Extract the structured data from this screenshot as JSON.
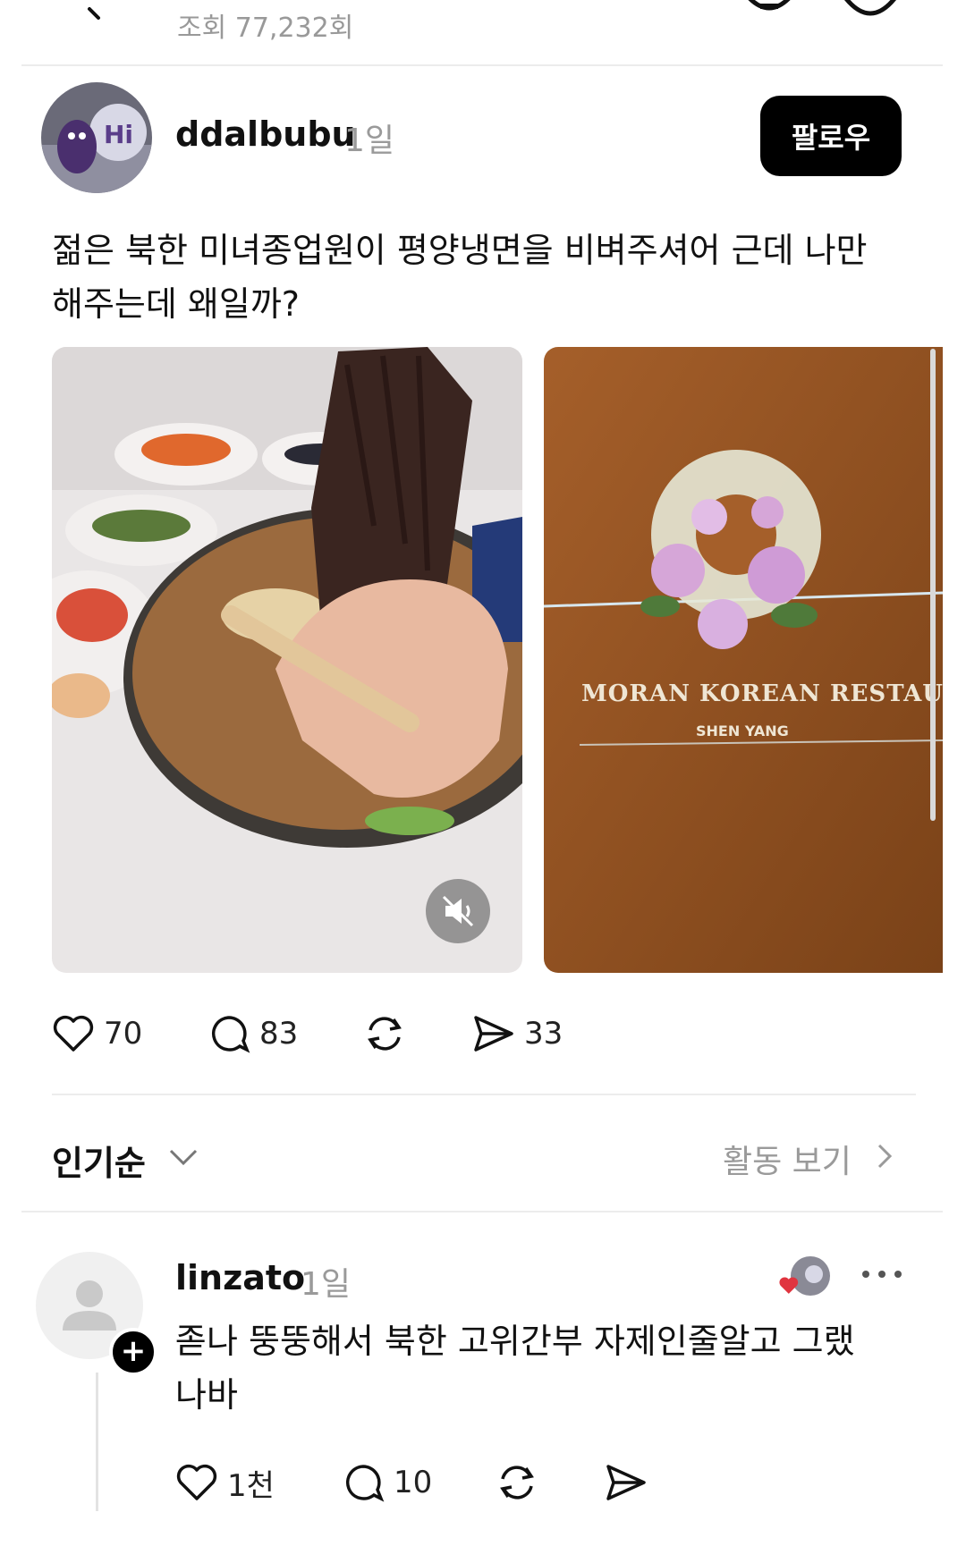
{
  "header": {
    "views": "조회 77,232회"
  },
  "post": {
    "author": "ddalbubu",
    "time": "1일",
    "follow_label": "팔로우",
    "text": "젊은 북한 미녀종업원이 평양냉면을 비벼주셔어 근데 나만해주는데 왜일까?",
    "images": [
      {
        "sign_text": "MORAN KOREAN RESTAURANT",
        "sign_sub": "SHEN YANG"
      }
    ],
    "likes": "70",
    "comments": "83",
    "shares": "33"
  },
  "sort": {
    "label": "인기순",
    "activity_label": "활동 보기"
  },
  "comment": {
    "author": "linzato",
    "time": "1일",
    "text": "졷나 뚱뚱해서 북한 고위간부 자제인줄알고 그랬나바",
    "likes": "1천",
    "replies": "10"
  },
  "colors": {
    "text": "#111111",
    "muted": "#9a9a9a",
    "follow_bg": "#000000",
    "heart_red": "#e0343f"
  }
}
